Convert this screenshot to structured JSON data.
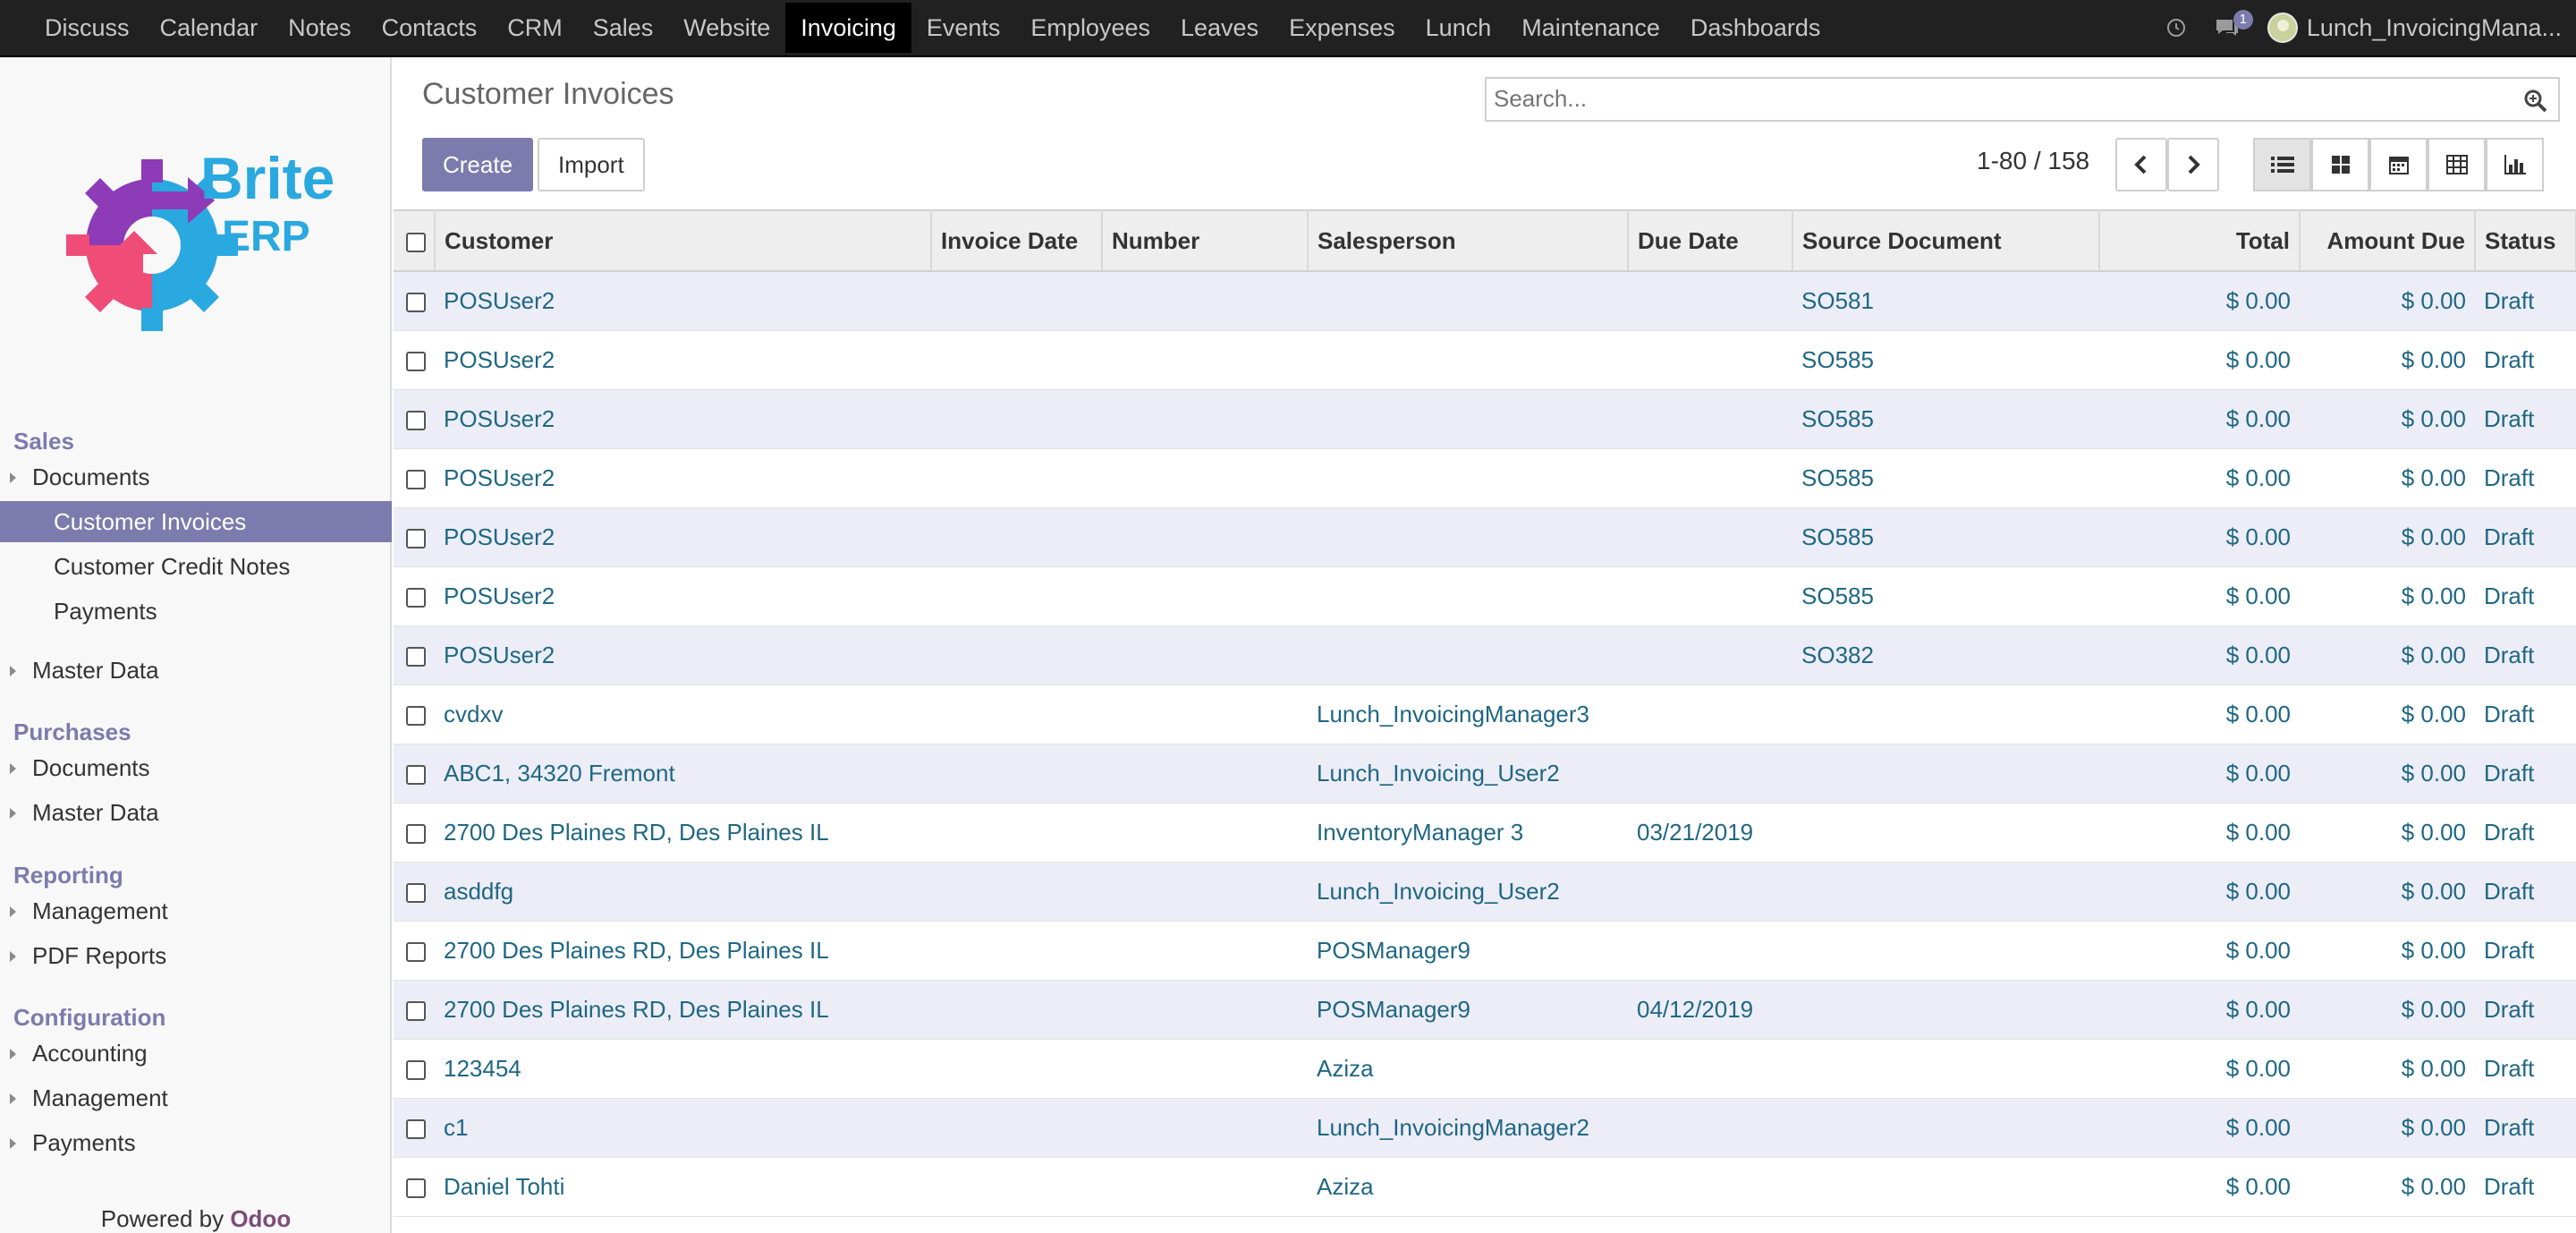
{
  "navbar": {
    "menu": [
      "Discuss",
      "Calendar",
      "Notes",
      "Contacts",
      "CRM",
      "Sales",
      "Website",
      "Invoicing",
      "Events",
      "Employees",
      "Leaves",
      "Expenses",
      "Lunch",
      "Maintenance",
      "Dashboards"
    ],
    "active_menu": "Invoicing",
    "chat_count": "1",
    "user_name": "Lunch_InvoicingMana..."
  },
  "logo": {
    "line1": "Brite",
    "line2": "ERP"
  },
  "sidebar": {
    "sections": [
      {
        "title": "Sales",
        "items": [
          {
            "label": "Documents",
            "sub": false,
            "active": false
          },
          {
            "label": "Customer Invoices",
            "sub": true,
            "active": true
          },
          {
            "label": "Customer Credit Notes",
            "sub": true,
            "active": false
          },
          {
            "label": "Payments",
            "sub": true,
            "active": false
          },
          {
            "label": "Master Data",
            "sub": false,
            "active": false
          }
        ]
      },
      {
        "title": "Purchases",
        "items": [
          {
            "label": "Documents",
            "sub": false,
            "active": false
          },
          {
            "label": "Master Data",
            "sub": false,
            "active": false
          }
        ]
      },
      {
        "title": "Reporting",
        "items": [
          {
            "label": "Management",
            "sub": false,
            "active": false
          },
          {
            "label": "PDF Reports",
            "sub": false,
            "active": false
          }
        ]
      },
      {
        "title": "Configuration",
        "items": [
          {
            "label": "Accounting",
            "sub": false,
            "active": false
          },
          {
            "label": "Management",
            "sub": false,
            "active": false
          },
          {
            "label": "Payments",
            "sub": false,
            "active": false
          }
        ]
      }
    ],
    "powered_prefix": "Powered by",
    "powered_brand": "Odoo"
  },
  "control": {
    "title": "Customer Invoices",
    "search_placeholder": "Search...",
    "create_label": "Create",
    "import_label": "Import",
    "pager": "1-80 / 158"
  },
  "table": {
    "columns": [
      "Customer",
      "Invoice Date",
      "Number",
      "Salesperson",
      "Due Date",
      "Source Document",
      "Total",
      "Amount Due",
      "Status"
    ],
    "rows": [
      [
        "POSUser2",
        "",
        "",
        "",
        "",
        "SO581",
        "$ 0.00",
        "$ 0.00",
        "Draft"
      ],
      [
        "POSUser2",
        "",
        "",
        "",
        "",
        "SO585",
        "$ 0.00",
        "$ 0.00",
        "Draft"
      ],
      [
        "POSUser2",
        "",
        "",
        "",
        "",
        "SO585",
        "$ 0.00",
        "$ 0.00",
        "Draft"
      ],
      [
        "POSUser2",
        "",
        "",
        "",
        "",
        "SO585",
        "$ 0.00",
        "$ 0.00",
        "Draft"
      ],
      [
        "POSUser2",
        "",
        "",
        "",
        "",
        "SO585",
        "$ 0.00",
        "$ 0.00",
        "Draft"
      ],
      [
        "POSUser2",
        "",
        "",
        "",
        "",
        "SO585",
        "$ 0.00",
        "$ 0.00",
        "Draft"
      ],
      [
        "POSUser2",
        "",
        "",
        "",
        "",
        "SO382",
        "$ 0.00",
        "$ 0.00",
        "Draft"
      ],
      [
        "cvdxv",
        "",
        "",
        "Lunch_InvoicingManager3",
        "",
        "",
        "$ 0.00",
        "$ 0.00",
        "Draft"
      ],
      [
        "ABC1, 34320 Fremont",
        "",
        "",
        "Lunch_Invoicing_User2",
        "",
        "",
        "$ 0.00",
        "$ 0.00",
        "Draft"
      ],
      [
        "2700 Des Plaines RD, Des Plaines IL",
        "",
        "",
        "InventoryManager 3",
        "03/21/2019",
        "",
        "$ 0.00",
        "$ 0.00",
        "Draft"
      ],
      [
        "asddfg",
        "",
        "",
        "Lunch_Invoicing_User2",
        "",
        "",
        "$ 0.00",
        "$ 0.00",
        "Draft"
      ],
      [
        "2700 Des Plaines RD, Des Plaines IL",
        "",
        "",
        "POSManager9",
        "",
        "",
        "$ 0.00",
        "$ 0.00",
        "Draft"
      ],
      [
        "2700 Des Plaines RD, Des Plaines IL",
        "",
        "",
        "POSManager9",
        "04/12/2019",
        "",
        "$ 0.00",
        "$ 0.00",
        "Draft"
      ],
      [
        "123454",
        "",
        "",
        "Aziza",
        "",
        "",
        "$ 0.00",
        "$ 0.00",
        "Draft"
      ],
      [
        "c1",
        "",
        "",
        "Lunch_InvoicingManager2",
        "",
        "",
        "$ 0.00",
        "$ 0.00",
        "Draft"
      ],
      [
        "Daniel Tohti",
        "",
        "",
        "Aziza",
        "",
        "",
        "$ 0.00",
        "$ 0.00",
        "Draft"
      ]
    ]
  },
  "colors": {
    "accent": "#7c7bad",
    "navbar": "#212121",
    "link": "#1f6784",
    "stripe": "#ecedf6"
  },
  "icons": [
    "clock-icon",
    "chat-icon",
    "search-icon",
    "chevron-left-icon",
    "chevron-right-icon",
    "list-view-icon",
    "kanban-view-icon",
    "calendar-view-icon",
    "pivot-view-icon",
    "graph-view-icon"
  ]
}
